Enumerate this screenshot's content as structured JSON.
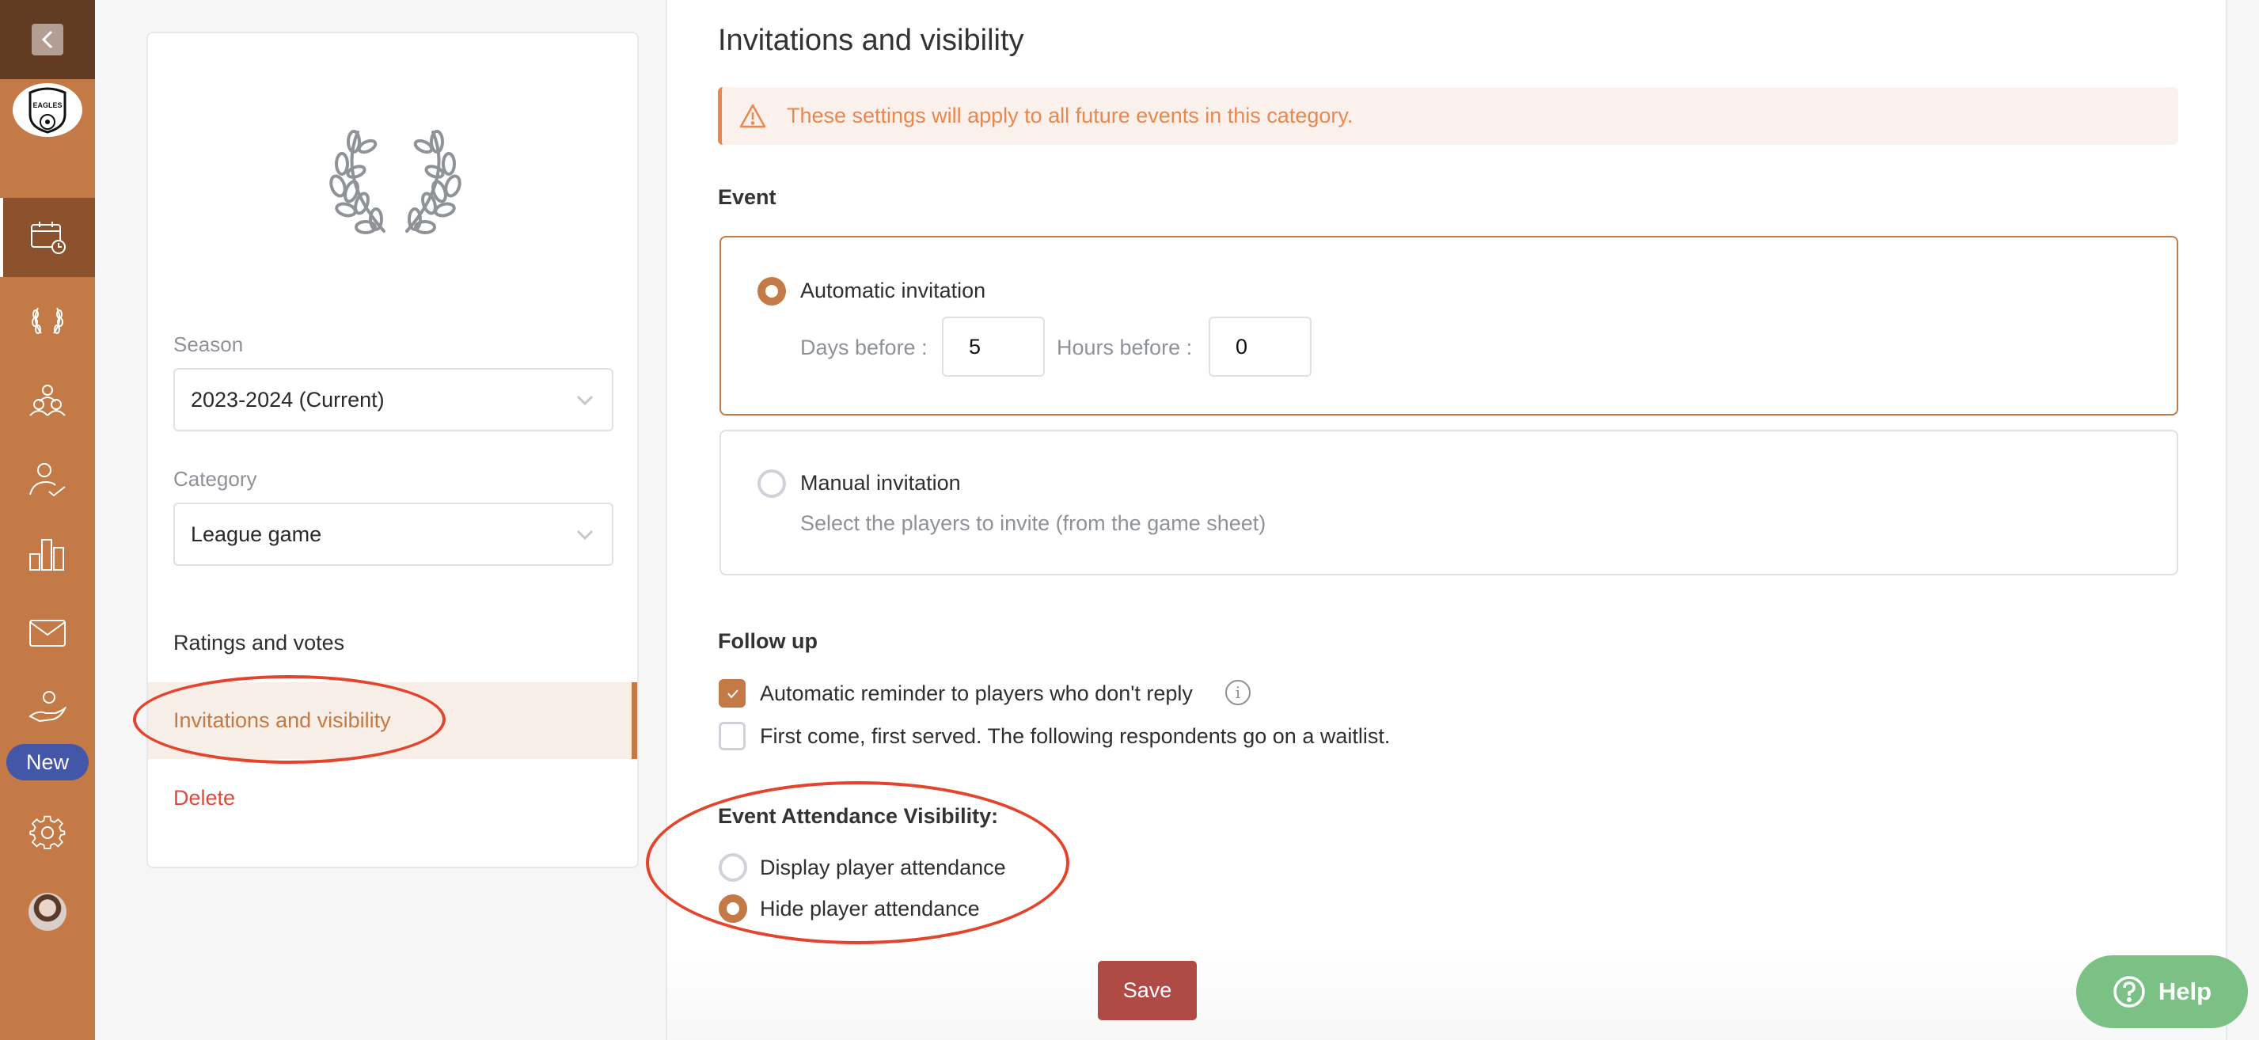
{
  "sidebar": {
    "back_icon": "chevron-left-icon",
    "logo_text": "EAGLES",
    "items": [
      {
        "name": "events",
        "icon": "calendar-clock-icon",
        "active": true
      },
      {
        "name": "competitions",
        "icon": "laurel-icon",
        "active": false
      },
      {
        "name": "teams",
        "icon": "group-icon",
        "active": false
      },
      {
        "name": "attendance",
        "icon": "person-check-icon",
        "active": false
      },
      {
        "name": "statistics",
        "icon": "bar-chart-icon",
        "active": false
      },
      {
        "name": "messages",
        "icon": "mail-icon",
        "active": false
      },
      {
        "name": "sponsorship",
        "icon": "hand-person-icon",
        "active": false
      },
      {
        "name": "settings",
        "icon": "gear-icon",
        "active": false
      }
    ],
    "new_badge": "New"
  },
  "left_panel": {
    "season_label": "Season",
    "season_value": "2023-2024 (Current)",
    "category_label": "Category",
    "category_value": "League game",
    "menu": [
      {
        "label": "Ratings and votes",
        "active": false
      },
      {
        "label": "Invitations and visibility",
        "active": true
      },
      {
        "label": "Delete",
        "danger": true
      }
    ]
  },
  "main": {
    "title": "Invitations and visibility",
    "banner_text": "These settings will apply to all future events in this category.",
    "event_section_label": "Event",
    "automatic": {
      "label": "Automatic invitation",
      "selected": true,
      "days_label": "Days before :",
      "days_value": "5",
      "hours_label": "Hours before :",
      "hours_value": "0"
    },
    "manual": {
      "label": "Manual invitation",
      "selected": false,
      "description": "Select the players to invite (from the game sheet)"
    },
    "follow_up_label": "Follow up",
    "reminder": {
      "label": "Automatic reminder to players who don't reply",
      "checked": true,
      "info_icon": "i"
    },
    "first_come": {
      "label": "First come, first served. The following respondents go on a waitlist.",
      "checked": false
    },
    "visibility_label": "Event Attendance Visibility:",
    "visibility_options": [
      {
        "label": "Display player attendance",
        "selected": false
      },
      {
        "label": "Hide player attendance",
        "selected": true
      }
    ],
    "save_label": "Save"
  },
  "help": {
    "label": "Help"
  },
  "colors": {
    "brand": "#c47a46",
    "brand_dark": "#623c22",
    "active_nav": "#8b522d",
    "warning": "#ea874d",
    "danger": "#e0483a",
    "save": "#b04a45",
    "help": "#7bc084",
    "new_badge": "#4356a8",
    "annotation": "#e5432c"
  }
}
